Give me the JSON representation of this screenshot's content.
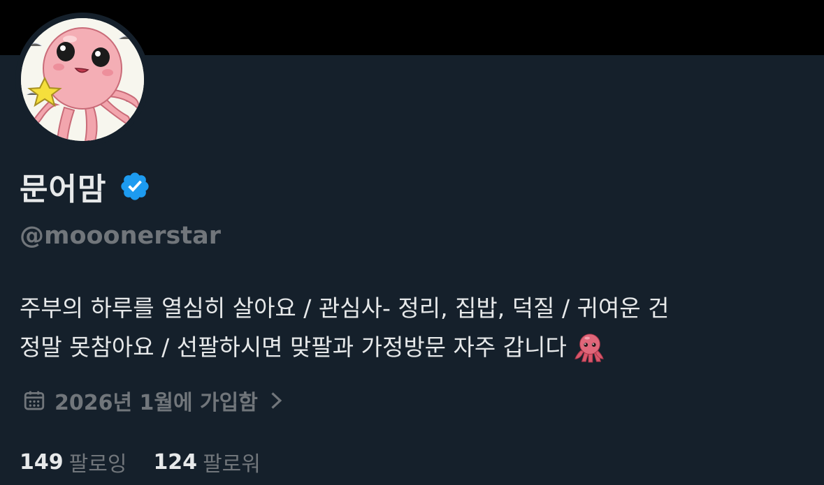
{
  "profile": {
    "display_name": "문어맘",
    "handle": "@mooonerstar",
    "verified_icon": "verified-badge-icon",
    "bio_lines": [
      "주부의 하루를 열심히 살아요 / 관심사- 정리, 집밥, 덕질 / 귀여운 건",
      "정말 못참아요 / 선팔하시면 맞팔과 가정방문 자주 갑니다"
    ],
    "bio_emoji": "octopus-emoji",
    "joined": "2026년 1월에 가입함",
    "joined_icon": "calendar-icon",
    "following_count": "149",
    "following_label": "팔로잉",
    "followers_count": "124",
    "followers_label": "팔로워"
  },
  "colors": {
    "background": "#15202b",
    "banner": "#000000",
    "text_primary": "#e7e9ea",
    "text_secondary": "#71767b",
    "verified_badge": "#1d9bf0"
  }
}
